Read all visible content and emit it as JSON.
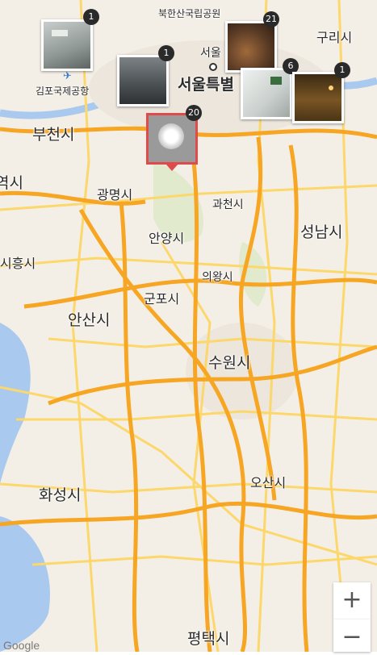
{
  "map": {
    "labels": {
      "bukhansan": "북한산국립공원",
      "guri": "구리시",
      "seoul_small": "서울",
      "seoul_large": "서울특별",
      "gimpo_airport": "김포국제공항",
      "bucheon": "부천시",
      "gwangmyeong": "광명시",
      "incheon_partial": "역시",
      "gwacheon": "과천시",
      "seongnam": "성남시",
      "anyang": "안양시",
      "siheung": "시흥시",
      "uiwang": "의왕시",
      "gunpo": "군포시",
      "ansan": "안산시",
      "suwon": "수원시",
      "hwaseong": "화성시",
      "osan": "오산시",
      "pyeongtaek": "평택시",
      "google": "Google"
    },
    "icons": {
      "airport": "airplane-icon",
      "city": "city-dot-icon"
    }
  },
  "markers": [
    {
      "count": "1",
      "thumb": "photo-thumb-gimpo",
      "color": "#9ba3a0"
    },
    {
      "count": "1",
      "thumb": "photo-thumb-street",
      "color": "#5e6366"
    },
    {
      "count": "21",
      "thumb": "photo-thumb-dining",
      "color": "#5a3b25"
    },
    {
      "count": "6",
      "thumb": "photo-thumb-window",
      "color": "#c9cfcc"
    },
    {
      "count": "1",
      "thumb": "photo-thumb-room",
      "color": "#6b4a1f"
    },
    {
      "count": "20",
      "thumb": "selected-photo-marker",
      "color": "#9a9a9a"
    }
  ],
  "zoom": {
    "in": "+",
    "out": "−"
  },
  "colors": {
    "road_major": "#f6a623",
    "road_minor": "#fcd76b",
    "water": "#a9c9ef",
    "land": "#f4efe6",
    "park": "#d8e6c3",
    "selected_border": "#e04a4a"
  }
}
